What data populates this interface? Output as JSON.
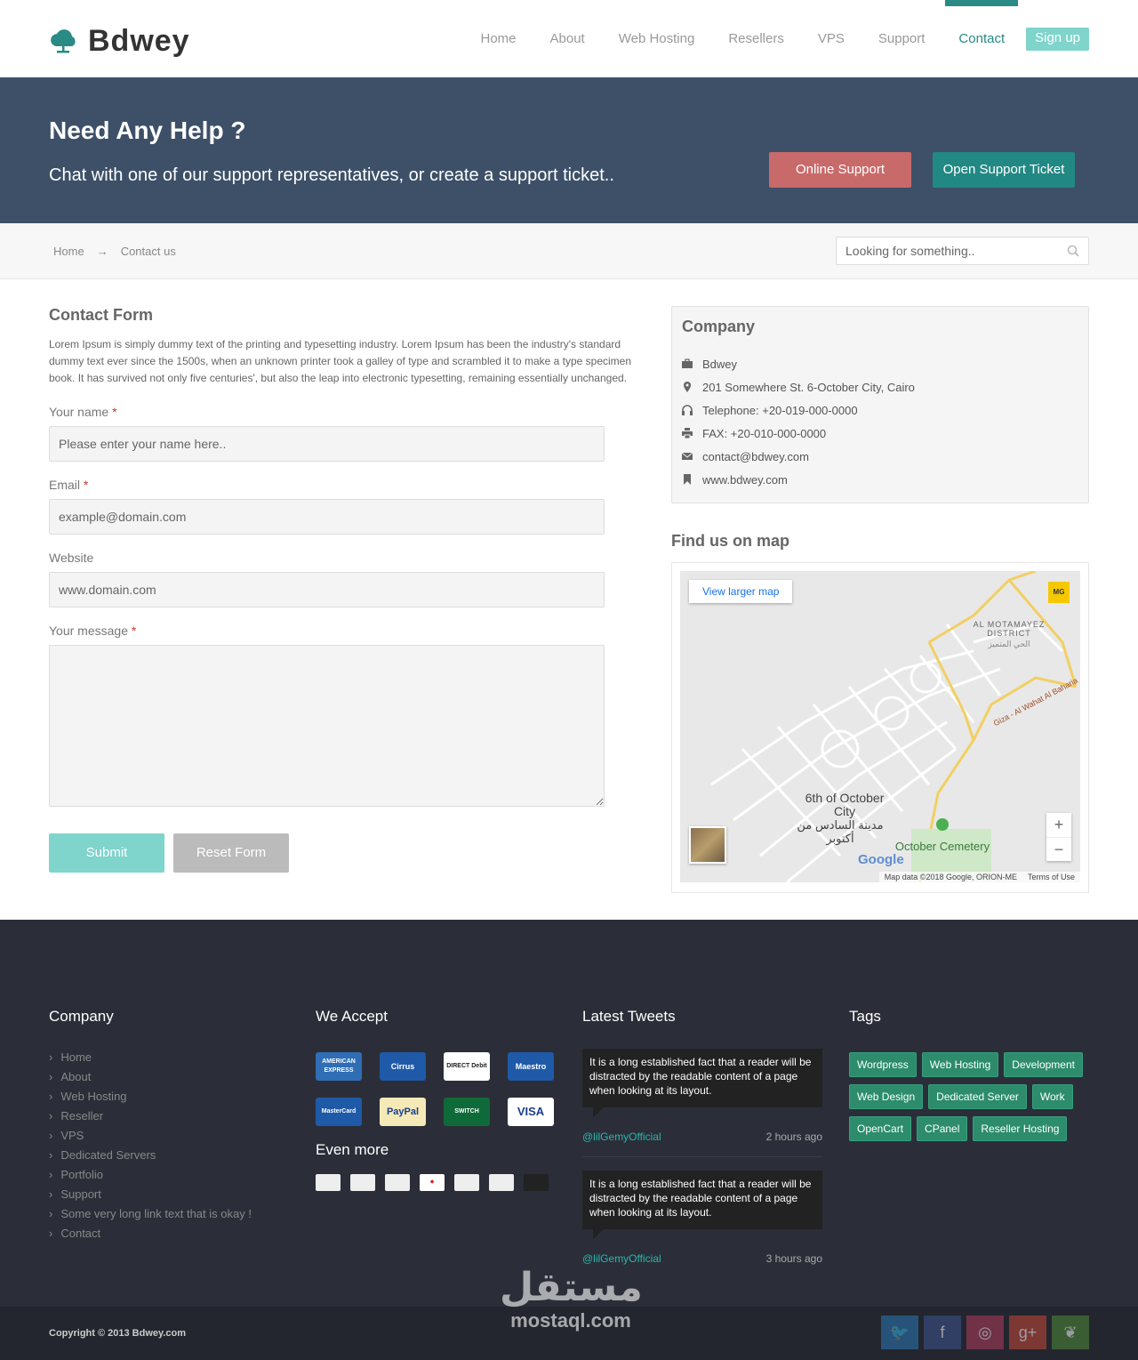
{
  "brand": {
    "name": "Bdwey"
  },
  "nav": {
    "items": [
      "Home",
      "About",
      "Web Hosting",
      "Resellers",
      "VPS",
      "Support",
      "Contact"
    ],
    "active": "Contact",
    "signup": "Sign up"
  },
  "hero": {
    "title": "Need Any Help ?",
    "subtitle": "Chat with one of our support representatives, or create a support ticket..",
    "online_support": "Online Support",
    "open_ticket": "Open Support Ticket"
  },
  "breadcrumb": {
    "home": "Home",
    "separator": "→",
    "current": "Contact us"
  },
  "search": {
    "placeholder": "Looking for something.."
  },
  "contact_form": {
    "title": "Contact Form",
    "description": "Lorem Ipsum is simply dummy text of the printing and typesetting industry. Lorem Ipsum has been the industry's standard dummy text ever since the 1500s, when an unknown printer took a galley of type and scrambled it to make a type specimen book. It has survived not only five centuries', but also the leap into electronic typesetting, remaining essentially unchanged.",
    "name_label": "Your name",
    "name_placeholder": "Please enter your name here..",
    "email_label": "Email",
    "email_placeholder": "example@domain.com",
    "website_label": "Website",
    "website_placeholder": "www.domain.com",
    "message_label": "Your message",
    "required_mark": "*",
    "submit": "Submit",
    "reset": "Reset Form"
  },
  "company": {
    "title": "Company",
    "items": [
      {
        "icon": "briefcase-icon",
        "text": "Bdwey"
      },
      {
        "icon": "map-marker-icon",
        "text": "201 Somewhere St. 6-October City, Cairo"
      },
      {
        "icon": "headphones-icon",
        "text": "Telephone: +20-019-000-0000"
      },
      {
        "icon": "printer-icon",
        "text": "FAX: +20-010-000-0000"
      },
      {
        "icon": "envelope-icon",
        "text": "contact@bdwey.com"
      },
      {
        "icon": "bookmark-icon",
        "text": "www.bdwey.com"
      }
    ]
  },
  "map": {
    "title": "Find us on map",
    "view_larger": "View larger map",
    "badge": "MG",
    "labels": {
      "district_en": "AL MOTAMAYEZ DISTRICT",
      "district_ar": "الحي المتميز",
      "road": "Giza - Al Wahat Al Baharia",
      "city_en": "6th of October City",
      "city_ar": "مدينة السادس من أكتوبر",
      "cemetery": "October Cemetery"
    },
    "google": "Google",
    "attribution": "Map data ©2018 Google, ORION-ME",
    "terms": "Terms of Use",
    "zoom_in": "+",
    "zoom_out": "−"
  },
  "footer": {
    "company": {
      "title": "Company",
      "links": [
        "Home",
        "About",
        "Web Hosting",
        "Reseller",
        "VPS",
        "Dedicated Servers",
        "Portfolio",
        "Support",
        "Some very long link text that is okay !",
        "Contact"
      ]
    },
    "accept": {
      "title": "We Accept",
      "cards": [
        "AMERICAN EXPRESS",
        "Cirrus",
        "DIRECT Debit",
        "Maestro",
        "MasterCard",
        "PayPal",
        "SWITCH",
        "VISA"
      ],
      "even_more": "Even more"
    },
    "tweets": {
      "title": "Latest Tweets",
      "items": [
        {
          "text": "It is a long established fact that a reader will be distracted by the readable content of a page when looking at its layout.",
          "handle": "@lilGemyOfficial",
          "time": "2 hours ago"
        },
        {
          "text": "It is a long established fact that a reader will be distracted by the readable content of a page when looking at its layout.",
          "handle": "@lilGemyOfficial",
          "time": "3 hours ago"
        }
      ]
    },
    "tags": {
      "title": "Tags",
      "items": [
        "Wordpress",
        "Web Hosting",
        "Development",
        "Web Design",
        "Dedicated Server",
        "Work",
        "OpenCart",
        "CPanel",
        "Reseller Hosting"
      ]
    }
  },
  "copyright": "Copyright © 2013 Bdwey.com",
  "socials": [
    "twitter-icon",
    "facebook-icon",
    "dribbble-icon",
    "google-plus-icon",
    "leaf-icon"
  ],
  "watermark": {
    "ar": "مستقل",
    "en": "mostaql.com"
  },
  "colors": {
    "accent": "#2a8a85",
    "hero": "#3d5068",
    "online": "#c86a6a",
    "footer": "#2b2e38",
    "tag": "#2c8c6c"
  }
}
